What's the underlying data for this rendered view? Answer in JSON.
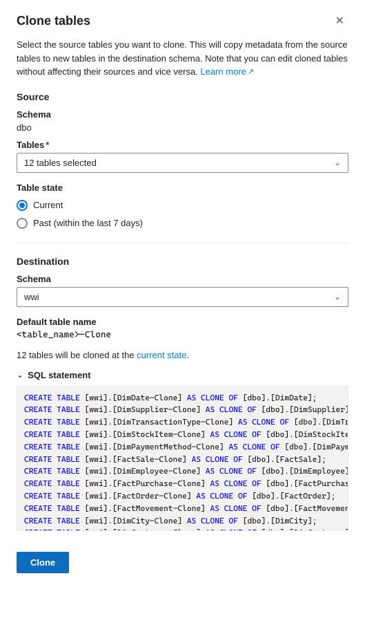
{
  "dialog": {
    "title": "Clone tables",
    "close_label": "✕"
  },
  "description": {
    "text": "Select the source tables you want to clone. This will copy metadata from the source tables to new tables in the destination schema. Note that you can edit cloned tables without affecting their sources and vice versa.",
    "link_text": "Learn more",
    "link_icon": "↗"
  },
  "source": {
    "label": "Source",
    "schema_label": "Schema",
    "schema_value": "dbo",
    "tables_label": "Tables",
    "tables_required": "*",
    "tables_selected": "12 tables selected"
  },
  "table_state": {
    "label": "Table state",
    "options": [
      {
        "id": "current",
        "label": "Current",
        "selected": true
      },
      {
        "id": "past",
        "label": "Past (within the last 7 days)",
        "selected": false
      }
    ]
  },
  "destination": {
    "label": "Destination",
    "schema_label": "Schema",
    "schema_value": "wwi",
    "default_table_name_label": "Default table name",
    "default_table_name_value": "<table_name>-Clone"
  },
  "summary": {
    "text_prefix": "12 tables will be cloned at the ",
    "text_highlight": "current state",
    "text_suffix": "."
  },
  "sql_section": {
    "label": "SQL statement",
    "toggle_icon": "∨",
    "lines": [
      "CREATE TABLE [wwi].[DimDate-Clone] AS CLONE OF [dbo].[DimDate];",
      "CREATE TABLE [wwi].[DimSupplier-Clone] AS CLONE OF [dbo].[DimSupplier];",
      "CREATE TABLE [wwi].[DimTransactionType-Clone] AS CLONE OF [dbo].[DimTra",
      "CREATE TABLE [wwi].[DimStockItem-Clone] AS CLONE OF [dbo].[DimStockItem",
      "CREATE TABLE [wwi].[DimPaymentMethod-Clone] AS CLONE OF [dbo].[DimPayme",
      "CREATE TABLE [wwi].[FactSale-Clone] AS CLONE OF [dbo].[FactSale];",
      "CREATE TABLE [wwi].[DimEmployee-Clone] AS CLONE OF [dbo].[DimEmployee];",
      "CREATE TABLE [wwi].[FactPurchase-Clone] AS CLONE OF [dbo].[FactPurchase",
      "CREATE TABLE [wwi].[FactOrder-Clone] AS CLONE OF [dbo].[FactOrder];",
      "CREATE TABLE [wwi].[FactMovement-Clone] AS CLONE OF [dbo].[FactMovement",
      "CREATE TABLE [wwi].[DimCity-Clone] AS CLONE OF [dbo].[DimCity];",
      "CREATE TABLE [wwi].[DimCustomer-Clone] AS CLONE OF [dbo].[DimCustomer];"
    ]
  },
  "footer": {
    "clone_button_label": "Clone"
  }
}
